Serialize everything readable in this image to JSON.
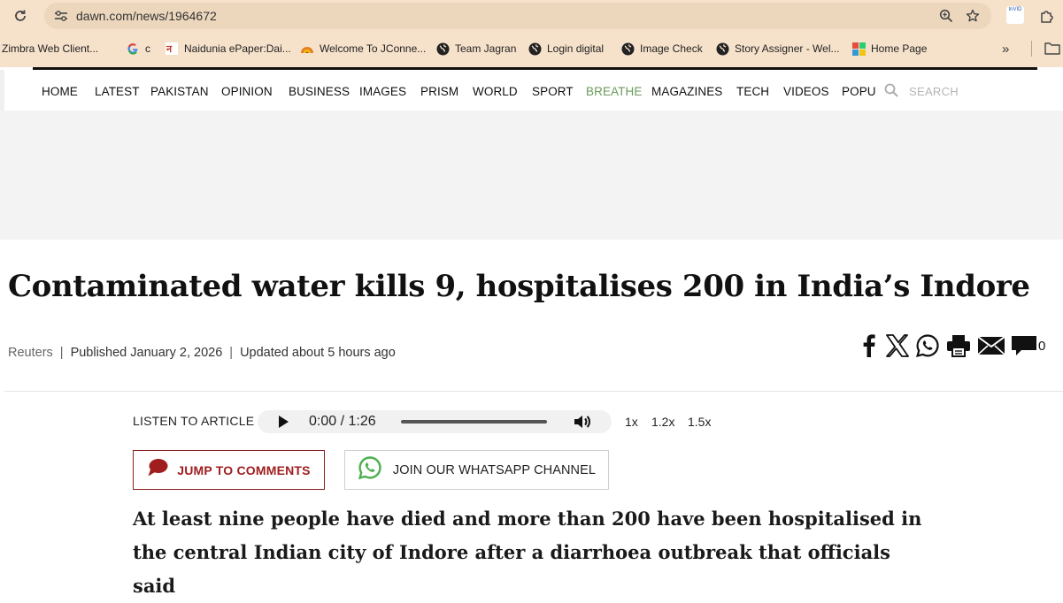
{
  "browser": {
    "url": "dawn.com/news/1964672",
    "invid_label": "InVID",
    "bookmarks": [
      {
        "label": "Zimbra Web Client...",
        "icon": "zimbra-icon"
      },
      {
        "label": "c",
        "icon": "google-icon"
      },
      {
        "label": "Naidunia ePaper:Dai...",
        "icon": "naidunia-icon"
      },
      {
        "label": "Welcome To JConne...",
        "icon": "jconnect-icon"
      },
      {
        "label": "Team Jagran",
        "icon": "globe-icon"
      },
      {
        "label": "Login digital",
        "icon": "globe-icon"
      },
      {
        "label": "Image Check",
        "icon": "globe-icon"
      },
      {
        "label": "Story Assigner - Wel...",
        "icon": "globe-icon"
      },
      {
        "label": "Home Page",
        "icon": "homepage-icon"
      }
    ],
    "more_label": "»"
  },
  "nav": {
    "items": [
      "HOME",
      "LATEST",
      "PAKISTAN",
      "OPINION",
      "BUSINESS",
      "IMAGES",
      "PRISM",
      "WORLD",
      "SPORT",
      "BREATHE",
      "MAGAZINES",
      "TECH",
      "VIDEOS",
      "POPU"
    ],
    "highlight_color": "#6b9a5b",
    "search_placeholder": "SEARCH"
  },
  "article": {
    "headline": "Contaminated water kills 9, hospitalises 200 in India’s Indore",
    "source": "Reuters",
    "published": "Published January 2, 2026",
    "updated": "Updated about 5 hours ago",
    "comment_count": "0",
    "listen_label": "LISTEN TO ARTICLE",
    "audio_time": "0:00 / 1:26",
    "speeds": [
      "1x",
      "1.2x",
      "1.5x"
    ],
    "jump_comments": "JUMP TO COMMENTS",
    "whatsapp": "JOIN OUR WHATSAPP CHANNEL",
    "lead": "At least nine people have died and more than 200 have been hospitalised in the central Indian city of Indore after a diarrhoea outbreak that officials said"
  },
  "colors": {
    "chrome": "#f6e2cb",
    "comments_red": "#a01e1e",
    "whatsapp_green": "#4caf50"
  }
}
